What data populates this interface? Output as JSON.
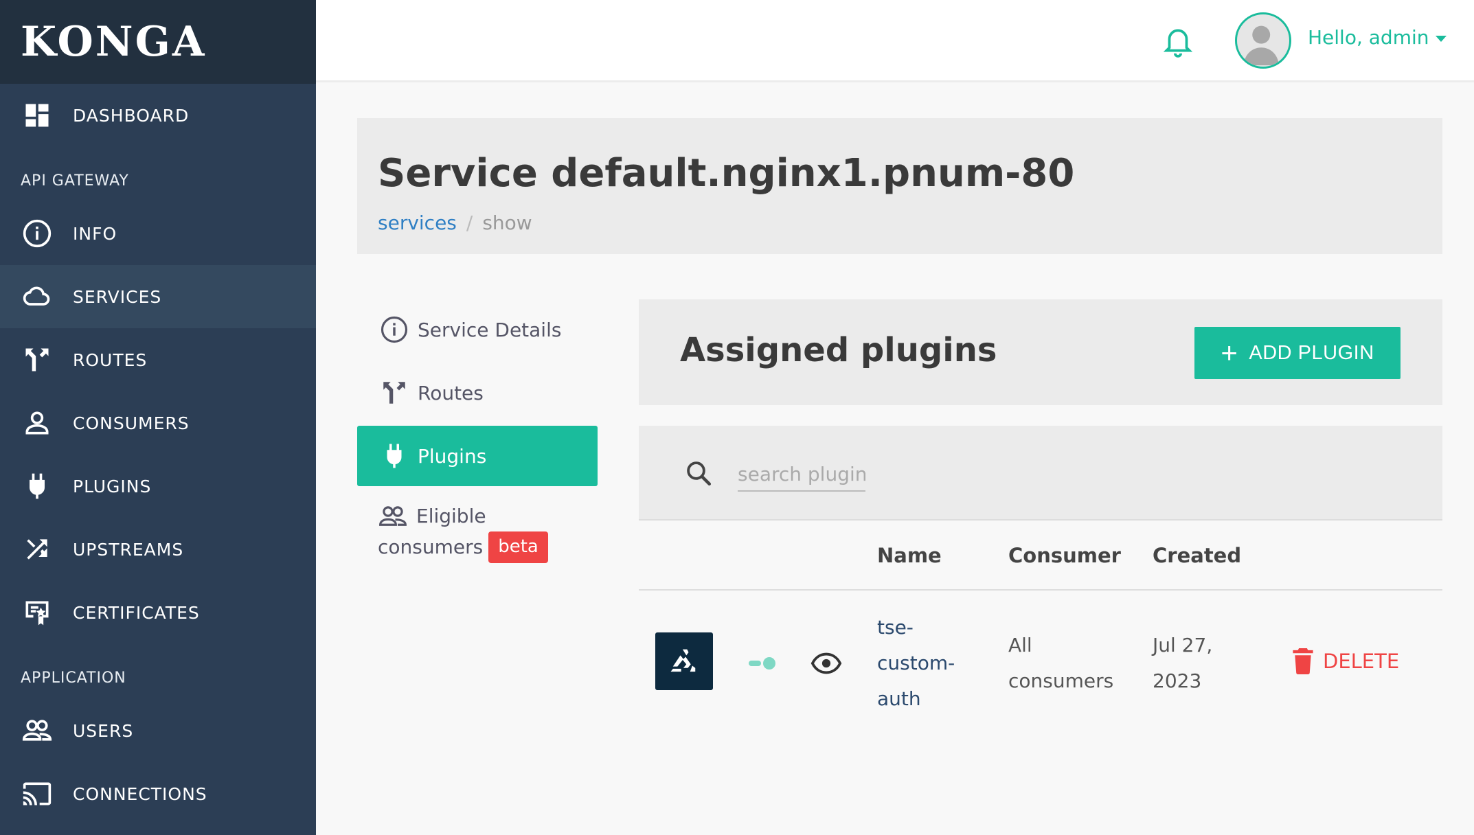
{
  "brand": "KONGA",
  "sidebar": {
    "dashboard": "DASHBOARD",
    "section_api": "API GATEWAY",
    "api_items": [
      {
        "label": "INFO",
        "icon": "info-icon"
      },
      {
        "label": "SERVICES",
        "icon": "cloud-icon"
      },
      {
        "label": "ROUTES",
        "icon": "routes-icon"
      },
      {
        "label": "CONSUMERS",
        "icon": "user-icon"
      },
      {
        "label": "PLUGINS",
        "icon": "plug-icon"
      },
      {
        "label": "UPSTREAMS",
        "icon": "shuffle-icon"
      },
      {
        "label": "CERTIFICATES",
        "icon": "certificate-icon"
      }
    ],
    "section_app": "APPLICATION",
    "app_items": [
      {
        "label": "USERS",
        "icon": "users-icon"
      },
      {
        "label": "CONNECTIONS",
        "icon": "cast-icon"
      }
    ],
    "active": "SERVICES"
  },
  "topbar": {
    "greeting": "Hello, admin"
  },
  "header": {
    "title": "Service default.nginx1.pnum-80",
    "breadcrumb": {
      "link": "services",
      "separator": "/",
      "current": "show"
    }
  },
  "subnav": {
    "service_details": "Service Details",
    "routes": "Routes",
    "plugins": "Plugins",
    "eligible_line1": "Eligible",
    "eligible_line2": "consumers",
    "beta": "beta"
  },
  "plugins_panel": {
    "title": "Assigned plugins",
    "add_button": "ADD PLUGIN",
    "search_placeholder": "search plugins...",
    "columns": {
      "name": "Name",
      "consumer": "Consumer",
      "created": "Created"
    },
    "rows": [
      {
        "name": "tse-custom-auth",
        "consumer": "All consumers",
        "created": "Jul 27, 2023",
        "delete_label": "DELETE"
      }
    ]
  },
  "colors": {
    "accent": "#1abc9c",
    "sidebar": "#2c3e55",
    "danger": "#ef4444",
    "link": "#2f7fc4"
  }
}
